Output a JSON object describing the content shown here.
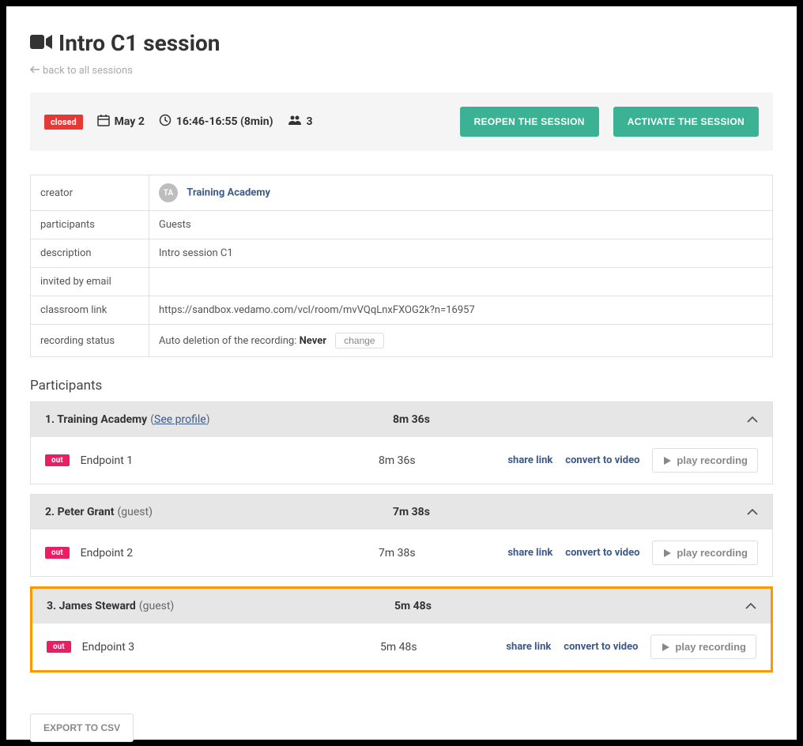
{
  "header": {
    "title": "Intro C1 session",
    "back_label": "back to all sessions"
  },
  "status": {
    "closed_badge": "closed",
    "date": "May 2",
    "time": "16:46-16:55 (8min)",
    "people_count": "3",
    "reopen_label": "REOPEN THE SESSION",
    "activate_label": "ACTIVATE THE SESSION"
  },
  "info": {
    "labels": {
      "creator": "creator",
      "participants": "participants",
      "description": "description",
      "invited": "invited by email",
      "link": "classroom link",
      "recording": "recording status"
    },
    "creator_initials": "TA",
    "creator_name": "Training Academy",
    "participants": "Guests",
    "description": "Intro session C1",
    "invited": "",
    "link": "https://sandbox.vedamo.com/vcl/room/mvVQqLnxFXOG2k?n=16957",
    "recording_prefix": "Auto deletion of the recording: ",
    "recording_value": "Never",
    "change_label": "change"
  },
  "participants_title": "Participants",
  "participants": [
    {
      "index": "1.",
      "name": "Training Academy",
      "extra_link": "See profile",
      "extra": "",
      "duration": "8m 36s",
      "endpoints": [
        {
          "out": "out",
          "name": "Endpoint 1",
          "duration": "8m 36s"
        }
      ]
    },
    {
      "index": "2.",
      "name": "Peter Grant",
      "extra": "(guest)",
      "duration": "7m 38s",
      "endpoints": [
        {
          "out": "out",
          "name": "Endpoint 2",
          "duration": "7m 38s"
        }
      ]
    },
    {
      "index": "3.",
      "name": "James Steward",
      "extra": "(guest)",
      "duration": "5m 48s",
      "highlight": true,
      "endpoints": [
        {
          "out": "out",
          "name": "Endpoint 3",
          "duration": "5m 48s"
        }
      ]
    }
  ],
  "actions": {
    "share": "share link",
    "convert": "convert to video",
    "play": "play recording"
  },
  "export_label": "EXPORT TO CSV"
}
